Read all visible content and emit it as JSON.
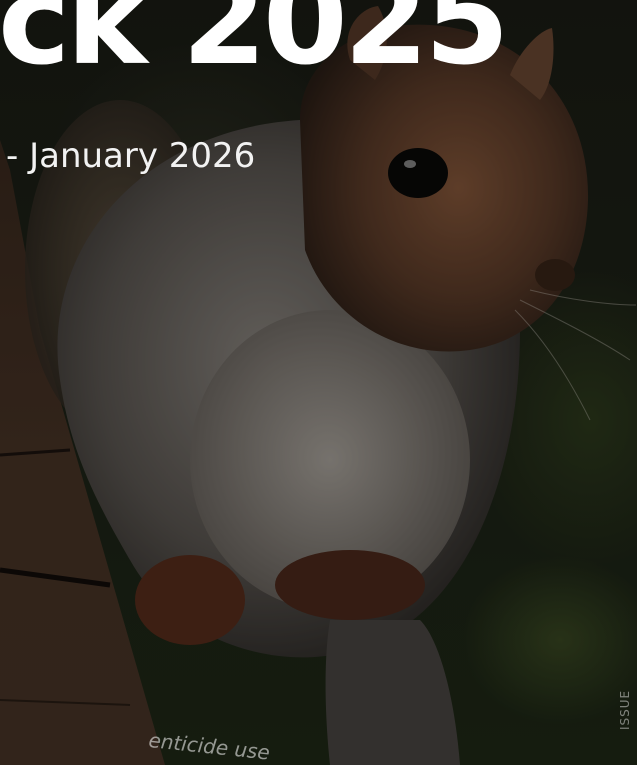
{
  "hero": {
    "title": "ck 2025",
    "subtitle": "- January 2026"
  },
  "background": {
    "subject": "grey squirrel photo",
    "overlay_color": "#000000",
    "tint": "dark"
  },
  "card": {
    "visible_text": "enticide use",
    "corner_text": "ISSUE"
  },
  "colors": {
    "title": "#ffffff",
    "subtitle": "#f2f2f2"
  }
}
